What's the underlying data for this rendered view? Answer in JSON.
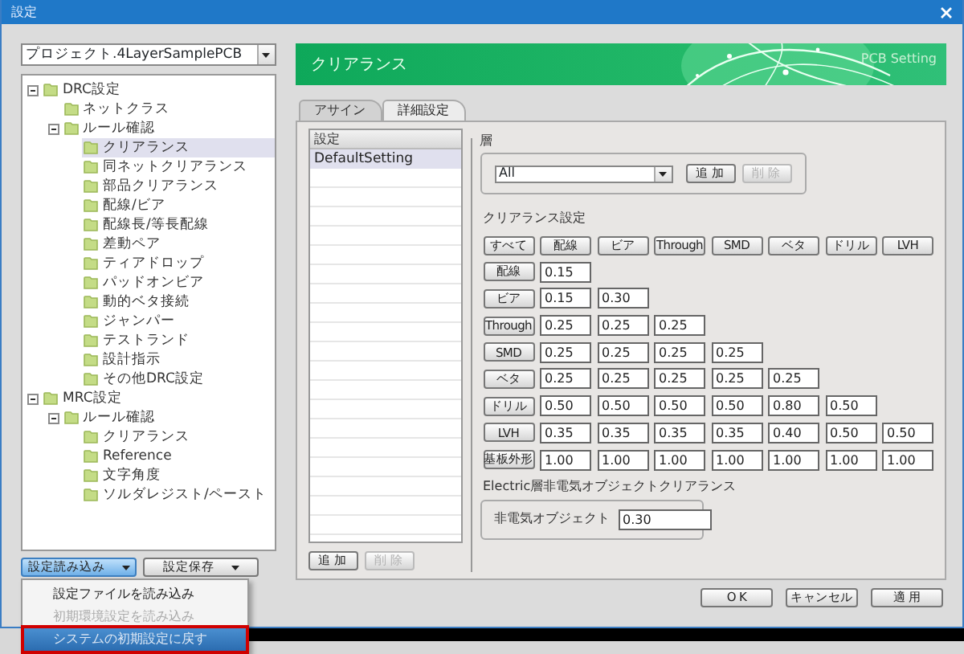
{
  "window": {
    "title": "設定"
  },
  "project_select": {
    "value": "プロジェクト.4LayerSamplePCB"
  },
  "tree": [
    {
      "label": "DRC設定",
      "expanded": true,
      "selected": false,
      "children": [
        {
          "label": "ネットクラス",
          "selected": false
        },
        {
          "label": "ルール確認",
          "expanded": true,
          "selected": false,
          "children": [
            {
              "label": "クリアランス",
              "selected": true
            },
            {
              "label": "同ネットクリアランス",
              "selected": false
            },
            {
              "label": "部品クリアランス",
              "selected": false
            },
            {
              "label": "配線/ビア",
              "selected": false
            },
            {
              "label": "配線長/等長配線",
              "selected": false
            },
            {
              "label": "差動ペア",
              "selected": false
            },
            {
              "label": "ティアドロップ",
              "selected": false
            },
            {
              "label": "パッドオンビア",
              "selected": false
            },
            {
              "label": "動的ベタ接続",
              "selected": false
            },
            {
              "label": "ジャンパー",
              "selected": false
            },
            {
              "label": "テストランド",
              "selected": false
            },
            {
              "label": "設計指示",
              "selected": false
            },
            {
              "label": "その他DRC設定",
              "selected": false
            }
          ]
        }
      ]
    },
    {
      "label": "MRC設定",
      "expanded": true,
      "selected": false,
      "children": [
        {
          "label": "ルール確認",
          "expanded": true,
          "selected": false,
          "children": [
            {
              "label": "クリアランス",
              "selected": false
            },
            {
              "label": "Reference",
              "selected": false
            },
            {
              "label": "文字角度",
              "selected": false
            },
            {
              "label": "ソルダレジスト/ペースト",
              "selected": false
            }
          ]
        }
      ]
    }
  ],
  "left_buttons": [
    {
      "label": "設定読み込み",
      "selected": true
    },
    {
      "label": "設定保存",
      "selected": false
    }
  ],
  "load_menu": [
    {
      "label": "設定ファイルを読み込み",
      "disabled": false,
      "highlighted": false,
      "outlined": false
    },
    {
      "label": "初期環境設定を読み込み",
      "disabled": true,
      "highlighted": false,
      "outlined": false
    },
    {
      "label": "システムの初期設定に戻す",
      "disabled": false,
      "highlighted": true,
      "outlined": true
    }
  ],
  "header": {
    "title": "クリアランス",
    "subtitle": "PCB Setting"
  },
  "tabs": [
    {
      "label": "アサイン",
      "selected": false
    },
    {
      "label": "詳細設定",
      "selected": true
    }
  ],
  "settings_list": {
    "header": "設定",
    "rows": [
      {
        "label": "DefaultSetting",
        "selected": true
      }
    ],
    "buttons": [
      {
        "label": "追 加",
        "disabled": false
      },
      {
        "label": "削 除",
        "disabled": true
      }
    ]
  },
  "layer": {
    "label": "層",
    "value": "All",
    "buttons": [
      {
        "label": "追 加",
        "disabled": false
      },
      {
        "label": "削 除",
        "disabled": true
      }
    ]
  },
  "clearance": {
    "label": "クリアランス設定",
    "column_buttons": [
      "すべて",
      "配線",
      "ビア",
      "Through",
      "SMD",
      "ベタ",
      "ドリル",
      "LVH"
    ],
    "rows": [
      {
        "button": "配線",
        "values": [
          "0.15"
        ]
      },
      {
        "button": "ビア",
        "values": [
          "0.15",
          "0.30"
        ]
      },
      {
        "button": "Through",
        "values": [
          "0.25",
          "0.25",
          "0.25"
        ]
      },
      {
        "button": "SMD",
        "values": [
          "0.25",
          "0.25",
          "0.25",
          "0.25"
        ]
      },
      {
        "button": "ベタ",
        "values": [
          "0.25",
          "0.25",
          "0.25",
          "0.25",
          "0.25"
        ]
      },
      {
        "button": "ドリル",
        "values": [
          "0.50",
          "0.50",
          "0.50",
          "0.50",
          "0.80",
          "0.50"
        ]
      },
      {
        "button": "LVH",
        "values": [
          "0.35",
          "0.35",
          "0.35",
          "0.35",
          "0.40",
          "0.50",
          "0.50"
        ]
      },
      {
        "button": "基板外形",
        "values": [
          "1.00",
          "1.00",
          "1.00",
          "1.00",
          "1.00",
          "1.00",
          "1.00"
        ]
      }
    ]
  },
  "non_electric": {
    "label": "Electric層非電気オブジェクトクリアランス",
    "field_label": "非電気オブジェクト",
    "value": "0.30"
  },
  "footer_buttons": [
    "O K",
    "キャンセル",
    "適 用"
  ]
}
